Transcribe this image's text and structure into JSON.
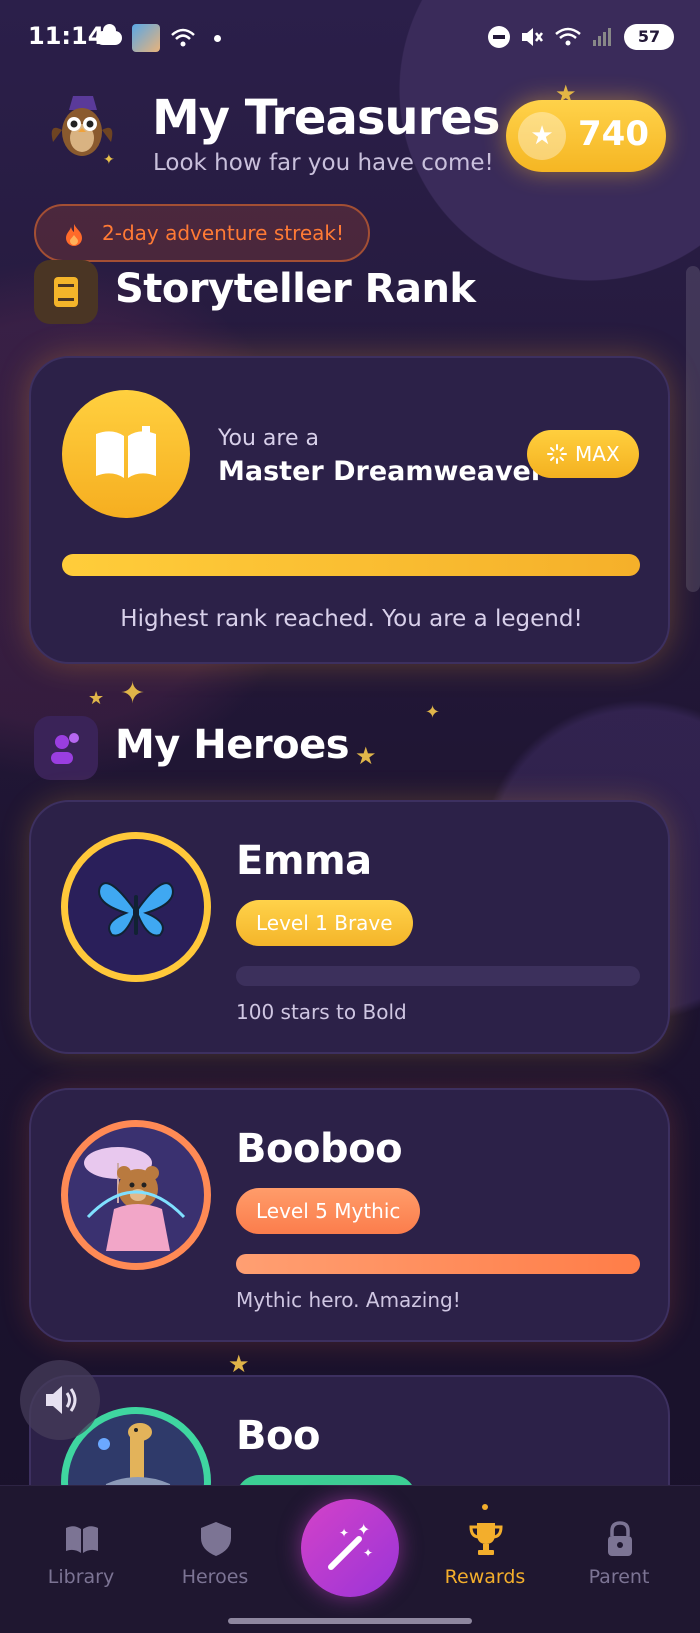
{
  "status_bar": {
    "time": "11:14",
    "battery": "57"
  },
  "header": {
    "title": "My Treasures",
    "subtitle": "Look how far you have come!",
    "coins": "740"
  },
  "streak": {
    "label": "2-day adventure streak!"
  },
  "rank_section": {
    "title": "Storyteller Rank",
    "prefix": "You are a",
    "rank_name": "Master Dreamweaver",
    "badge": "MAX",
    "progress": 1.0,
    "message": "Highest rank reached. You are a legend!"
  },
  "heroes_section": {
    "title": "My Heroes",
    "heroes": [
      {
        "name": "Emma",
        "level": "Level 1 Brave",
        "progress": 0.0,
        "message": "100 stars to Bold",
        "ring_color": "#ffc83a",
        "pill_color": "#f8c744",
        "bar_color": "#ffc83a",
        "avatar_icon": "butterfly-icon"
      },
      {
        "name": "Booboo",
        "level": "Level 5 Mythic",
        "progress": 1.0,
        "message": "Mythic hero. Amazing!",
        "ring_color": "#ff8a55",
        "pill_color": "#ff8b5c",
        "bar_color": "#ff8650",
        "avatar_icon": "bear-icon"
      },
      {
        "name": "Boo",
        "level": "",
        "progress": 0.0,
        "message": "",
        "ring_color": "#3fd6a0",
        "pill_color": "#3ccf94",
        "bar_color": "#3ccf94",
        "avatar_icon": "giraffe-icon"
      }
    ]
  },
  "nav": {
    "items": [
      {
        "label": "Library",
        "icon": "book-icon",
        "active": false
      },
      {
        "label": "Heroes",
        "icon": "shield-icon",
        "active": false
      },
      {
        "label": "Rewards",
        "icon": "trophy-icon",
        "active": true
      },
      {
        "label": "Parent",
        "icon": "lock-icon",
        "active": false
      }
    ],
    "active_color": "#f3ae2c",
    "inactive_color": "#7c7494"
  }
}
